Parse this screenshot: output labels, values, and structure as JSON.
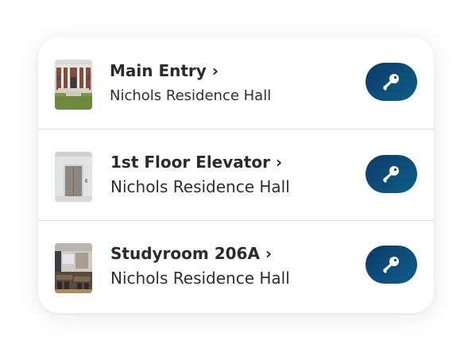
{
  "colors": {
    "key_button": "#0b4a73",
    "title_text": "#2b2b2b",
    "divider": "#dcdcdc"
  },
  "doors": [
    {
      "title": "Main Entry ›",
      "location": "Nichols Residence Hall",
      "thumbnail": "building-entrance-photo",
      "action_icon": "key-icon"
    },
    {
      "title": "1st Floor Elevator ›",
      "location": "Nichols Residence Hall",
      "thumbnail": "elevator-door-photo",
      "action_icon": "key-icon"
    },
    {
      "title": "Studyroom 206A ›",
      "location": "Nichols Residence Hall",
      "thumbnail": "study-room-photo",
      "action_icon": "key-icon"
    }
  ]
}
